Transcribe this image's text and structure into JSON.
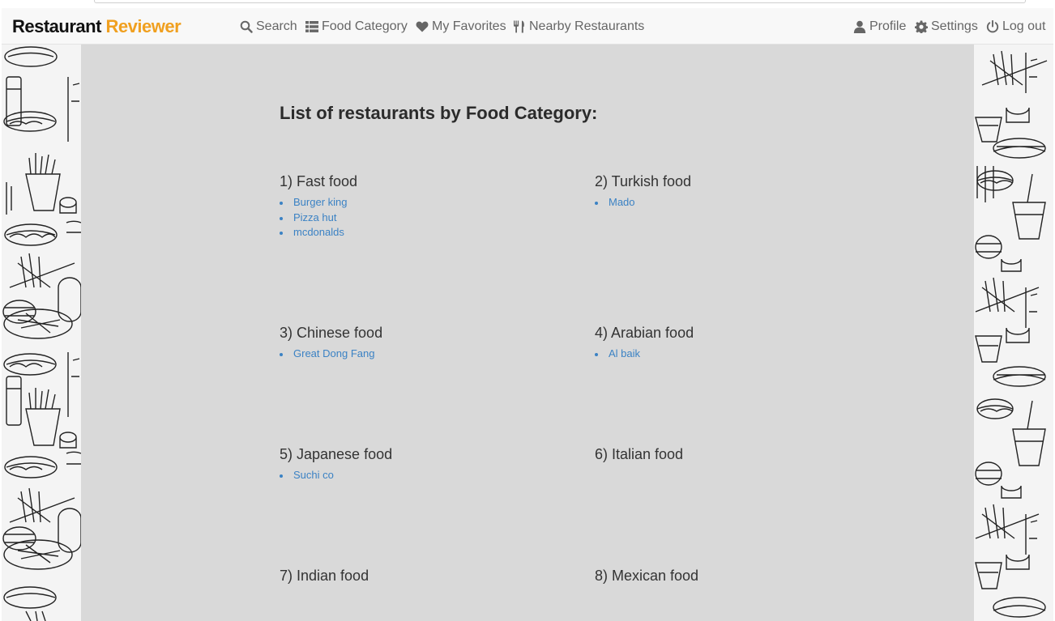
{
  "brand": {
    "name": "Restaurant",
    "accent": "Reviewer",
    "accent_color": "#f0a020"
  },
  "nav": {
    "left": [
      {
        "label": "Search",
        "icon": "search-icon"
      },
      {
        "label": "Food Category",
        "icon": "list-icon"
      },
      {
        "label": "My Favorites",
        "icon": "heart-icon"
      },
      {
        "label": "Nearby Restaurants",
        "icon": "cutlery-icon"
      }
    ],
    "right": [
      {
        "label": "Profile",
        "icon": "user-icon"
      },
      {
        "label": "Settings",
        "icon": "gear-icon"
      },
      {
        "label": "Log out",
        "icon": "power-icon"
      }
    ]
  },
  "heading": "List of restaurants by Food Category:",
  "link_color": "#3b82c4",
  "categories": [
    {
      "title": "1) Fast food",
      "restaurants": [
        "Burger king",
        "Pizza hut",
        "mcdonalds"
      ]
    },
    {
      "title": "2) Turkish food",
      "restaurants": [
        "Mado"
      ]
    },
    {
      "title": "3) Chinese food",
      "restaurants": [
        "Great Dong Fang"
      ]
    },
    {
      "title": "4) Arabian food",
      "restaurants": [
        "Al baik"
      ]
    },
    {
      "title": "5) Japanese food",
      "restaurants": [
        "Suchi co"
      ]
    },
    {
      "title": "6) Italian food",
      "restaurants": []
    },
    {
      "title": "7) Indian food",
      "restaurants": []
    },
    {
      "title": "8) Mexican food",
      "restaurants": []
    }
  ]
}
